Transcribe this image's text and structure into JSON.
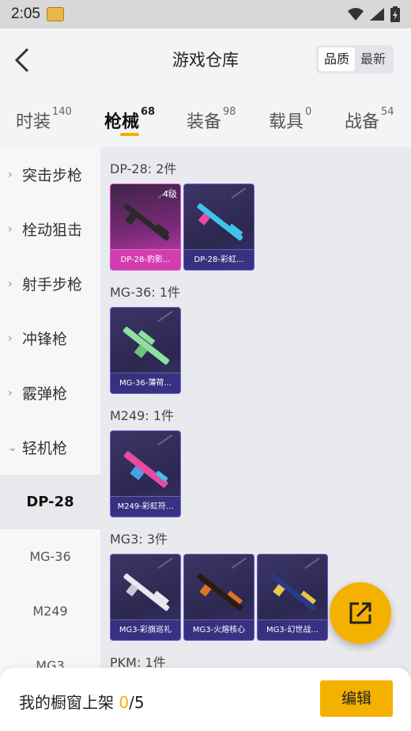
{
  "status_bar": {
    "time": "2:05"
  },
  "header": {
    "title": "游戏仓库",
    "sort": [
      "品质",
      "最新"
    ],
    "active_sort": 0
  },
  "tabs": [
    {
      "label": "时装",
      "count": "140"
    },
    {
      "label": "枪械",
      "count": "68"
    },
    {
      "label": "装备",
      "count": "98"
    },
    {
      "label": "载具",
      "count": "0"
    },
    {
      "label": "战备",
      "count": "54"
    }
  ],
  "active_tab": 1,
  "sidebar": {
    "categories": [
      "突击步枪",
      "栓动狙击",
      "射手步枪",
      "冲锋枪",
      "霰弹枪",
      "轻机枪"
    ],
    "subitems": [
      "DP-28",
      "MG-36",
      "M249",
      "MG3"
    ],
    "active_sub": "DP-28"
  },
  "groups": [
    {
      "title": "DP-28: 2件",
      "items": [
        {
          "name": "DP-28-豹影...",
          "level": "4级",
          "style": "pink",
          "gun_color": "#2a2a2a"
        },
        {
          "name": "DP-28-彩虹...",
          "style": "purple",
          "gun_color": "#3fc4e8"
        }
      ]
    },
    {
      "title": "MG-36: 1件",
      "items": [
        {
          "name": "MG-36-薄荷...",
          "style": "purple",
          "gun_color": "#8fe0a0"
        }
      ]
    },
    {
      "title": "M249: 1件",
      "items": [
        {
          "name": "M249-彩虹符...",
          "style": "purple",
          "gun_color": "#e84aa0"
        }
      ]
    },
    {
      "title": "MG3: 3件",
      "items": [
        {
          "name": "MG3-彩旗巡礼",
          "style": "purple",
          "gun_color": "#e8e8f0"
        },
        {
          "name": "MG3-火熔核心",
          "style": "purple",
          "gun_color": "#d8742a"
        },
        {
          "name": "MG3-幻世战...",
          "style": "purple",
          "gun_color": "#e8c84a"
        }
      ]
    },
    {
      "title": "PKM: 1件",
      "items": []
    }
  ],
  "bottom": {
    "shelf_label": "我的橱窗上架",
    "shelf_count": "0",
    "shelf_total": "/5",
    "edit_label": "编辑"
  },
  "colors": {
    "accent": "#f5b100",
    "card_border": "#6b5fd0",
    "card_pink": "#d43db0"
  }
}
